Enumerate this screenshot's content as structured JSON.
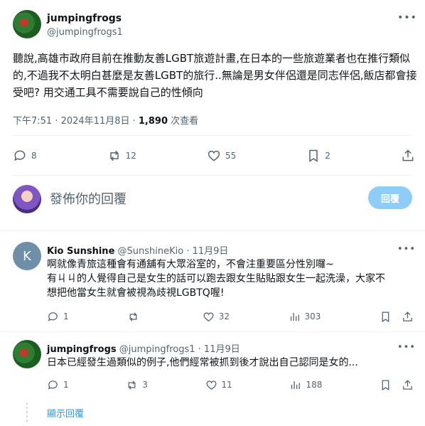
{
  "main_tweet": {
    "name": "jumpingfrogs",
    "handle": "@jumpingfrogs1",
    "text": "聽說,高雄市政府目前在推動友善LGBT旅遊計畫,在日本的一些旅遊業者也在推行類似的,不過我不太明白甚麼是友善LGBT的旅行..無論是男女伴侶還是同志伴侶,飯店都會接受吧? 用交通工具不需要說自己的性傾向",
    "time": "下午7:51 · 2024年11月8日 · ",
    "views": "1,890",
    "views_suffix": " 次查看",
    "actions": {
      "replies": "8",
      "reposts": "12",
      "likes": "55",
      "bookmarks": "2"
    }
  },
  "compose": {
    "placeholder": "發佈你的回覆",
    "button": "回覆"
  },
  "replies": [
    {
      "avatar_letter": "K",
      "name": "Kio Sunshine",
      "handle": "@SunshineKio",
      "date": " · 11月9日",
      "lines": [
        "啊就像青旅這種會有通舖有大眾浴室的，不會注重要區分性別囉~",
        "有ㄐㄐ的人覺得自己是女生的話可以跑去跟女生貼貼跟女生一起洗澡，大家不",
        "想把他當女生就會被視為歧視LGBTQ喔!"
      ],
      "actions": {
        "replies": "1",
        "reposts": "",
        "likes": "32",
        "views": "303"
      }
    },
    {
      "name": "jumpingfrogs",
      "handle": "@jumpingfrogs1",
      "date": " · 11月9日",
      "lines": [
        "日本已經發生過類似的例子,他們經常被抓到後才說出自己認同是女的..."
      ],
      "actions": {
        "replies": "1",
        "reposts": "3",
        "likes": "11",
        "views": "188"
      }
    }
  ],
  "show_replies": "顯示回覆"
}
